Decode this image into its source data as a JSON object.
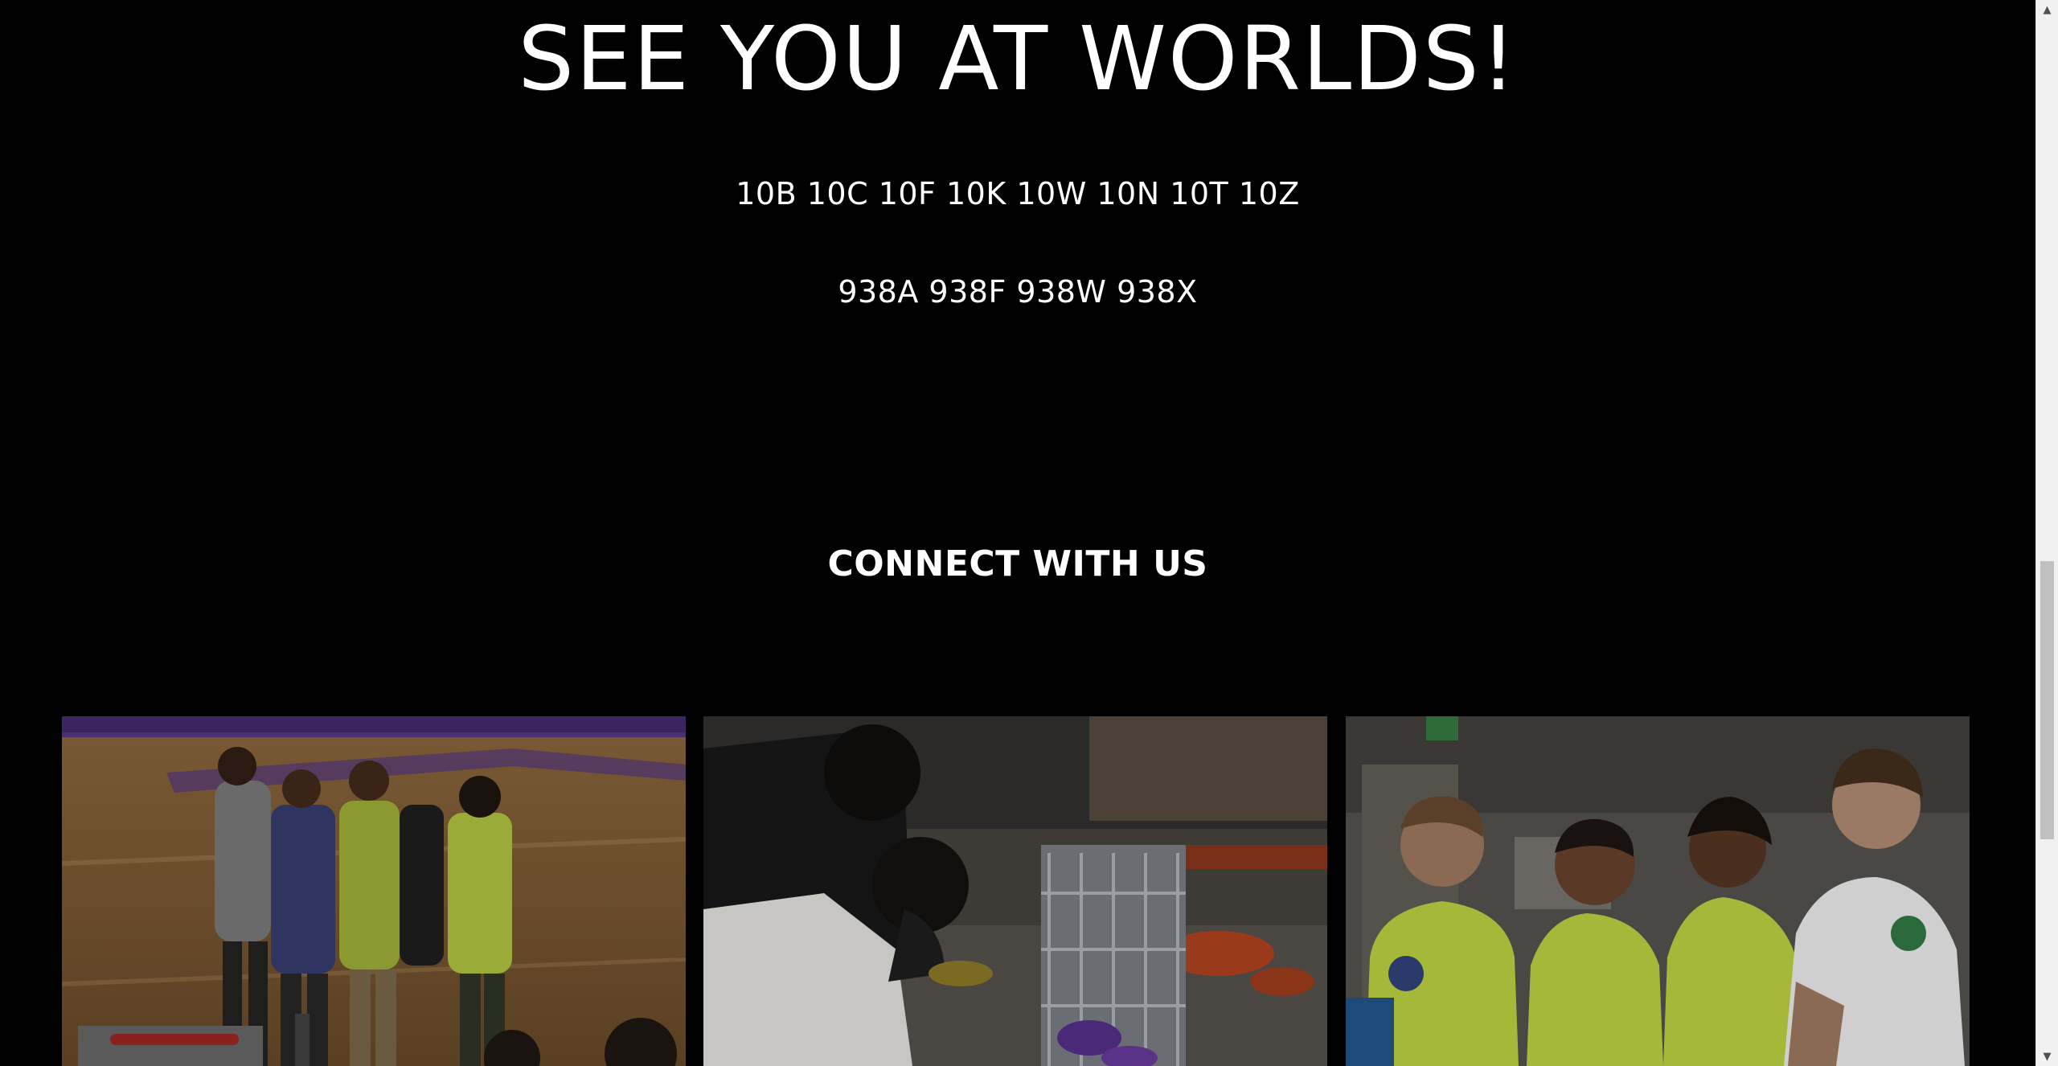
{
  "hero": {
    "title": "SEE YOU AT WORLDS!"
  },
  "teams": {
    "row1": "10B 10C 10F 10K 10W 10N 10T 10Z",
    "row2": "938A 938F 938W 938X"
  },
  "connect": {
    "heading": "CONNECT WITH US"
  },
  "gallery": {
    "photos": [
      "students-driving-robots-gym-photo",
      "students-building-robot-photo",
      "students-in-team-shirts-photo"
    ]
  },
  "scrollbar": {
    "up_icon": "▲",
    "down_icon": "▼"
  },
  "colors": {
    "background": "#000000",
    "text": "#ffffff",
    "team_shirt": "#c8e63c",
    "gym_accent": "#6b3fa0"
  }
}
